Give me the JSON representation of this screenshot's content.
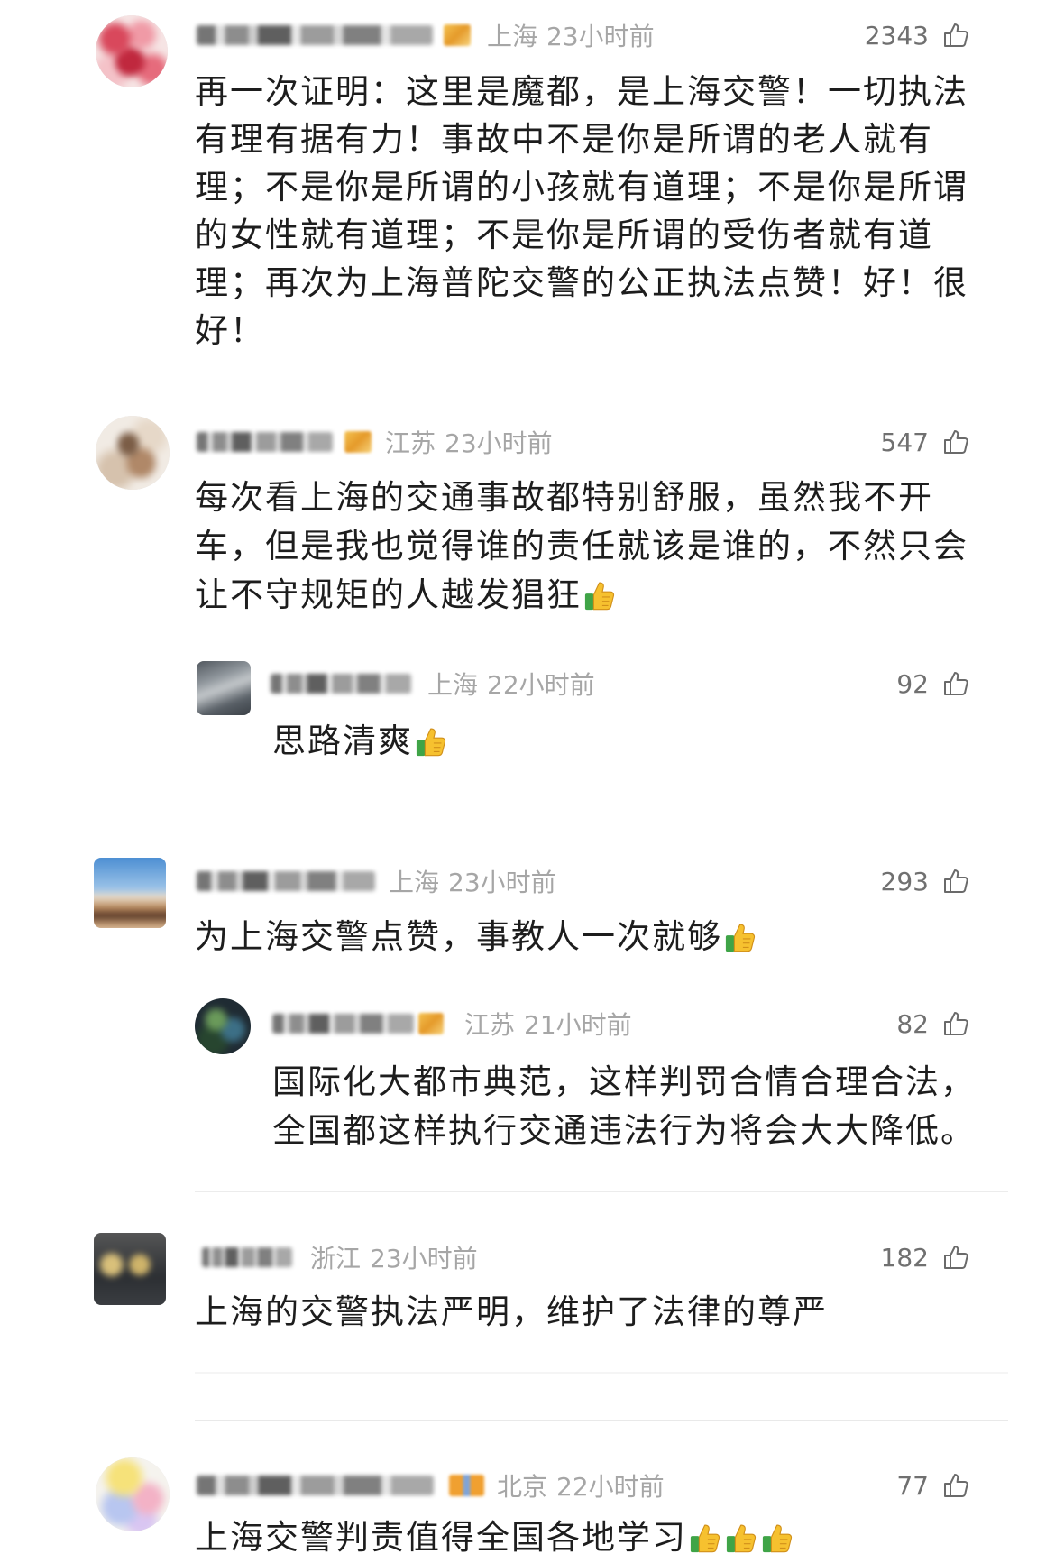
{
  "colors": {
    "text": "#1d1d1d",
    "meta": "#a6a6a6",
    "likes": "#707070",
    "sticker_thumb": "#f6c12f",
    "sticker_cuff": "#3fa447",
    "divider": "#ececec"
  },
  "comments": [
    {
      "location": "上海",
      "time": "23小时前",
      "likes": "2343",
      "lines": [
        "再一次证明：这里是魔都，是上海交警！一切执法",
        "有理有据有力！事故中不是你是所谓的老人就有",
        "理；不是你是所谓的小孩就有道理；不是你是所谓",
        "的女性就有道理；不是你是所谓的受伤者就有道",
        "理；再次为上海普陀交警的公正执法点赞！好！很",
        "好！"
      ],
      "stickers": [],
      "replies": []
    },
    {
      "location": "江苏",
      "time": "23小时前",
      "likes": "547",
      "lines": [
        "每次看上海的交通事故都特别舒服，虽然我不开",
        "车，但是我也觉得谁的责任就该是谁的，不然只会",
        "让不守规矩的人越发猖狂"
      ],
      "stickers": [
        "thumbs-up-sticker"
      ],
      "replies": [
        {
          "location": "上海",
          "time": "22小时前",
          "likes": "92",
          "lines": [
            "思路清爽"
          ],
          "stickers": [
            "thumbs-up-sticker"
          ]
        }
      ]
    },
    {
      "location": "上海",
      "time": "23小时前",
      "likes": "293",
      "lines": [
        "为上海交警点赞，事教人一次就够"
      ],
      "stickers": [
        "thumbs-up-sticker"
      ],
      "replies": [
        {
          "location": "江苏",
          "time": "21小时前",
          "likes": "82",
          "lines": [
            "国际化大都市典范，这样判罚合情合理合法，",
            "全国都这样执行交通违法行为将会大大降低。"
          ],
          "stickers": []
        }
      ]
    },
    {
      "location": "浙江",
      "time": "23小时前",
      "likes": "182",
      "lines": [
        "上海的交警执法严明，维护了法律的尊严"
      ],
      "stickers": [],
      "replies": []
    },
    {
      "location": "北京",
      "time": "22小时前",
      "likes": "77",
      "lines": [
        "上海交警判责值得全国各地学习"
      ],
      "stickers": [
        "thumbs-up-sticker",
        "thumbs-up-sticker",
        "thumbs-up-sticker"
      ],
      "replies": []
    }
  ]
}
